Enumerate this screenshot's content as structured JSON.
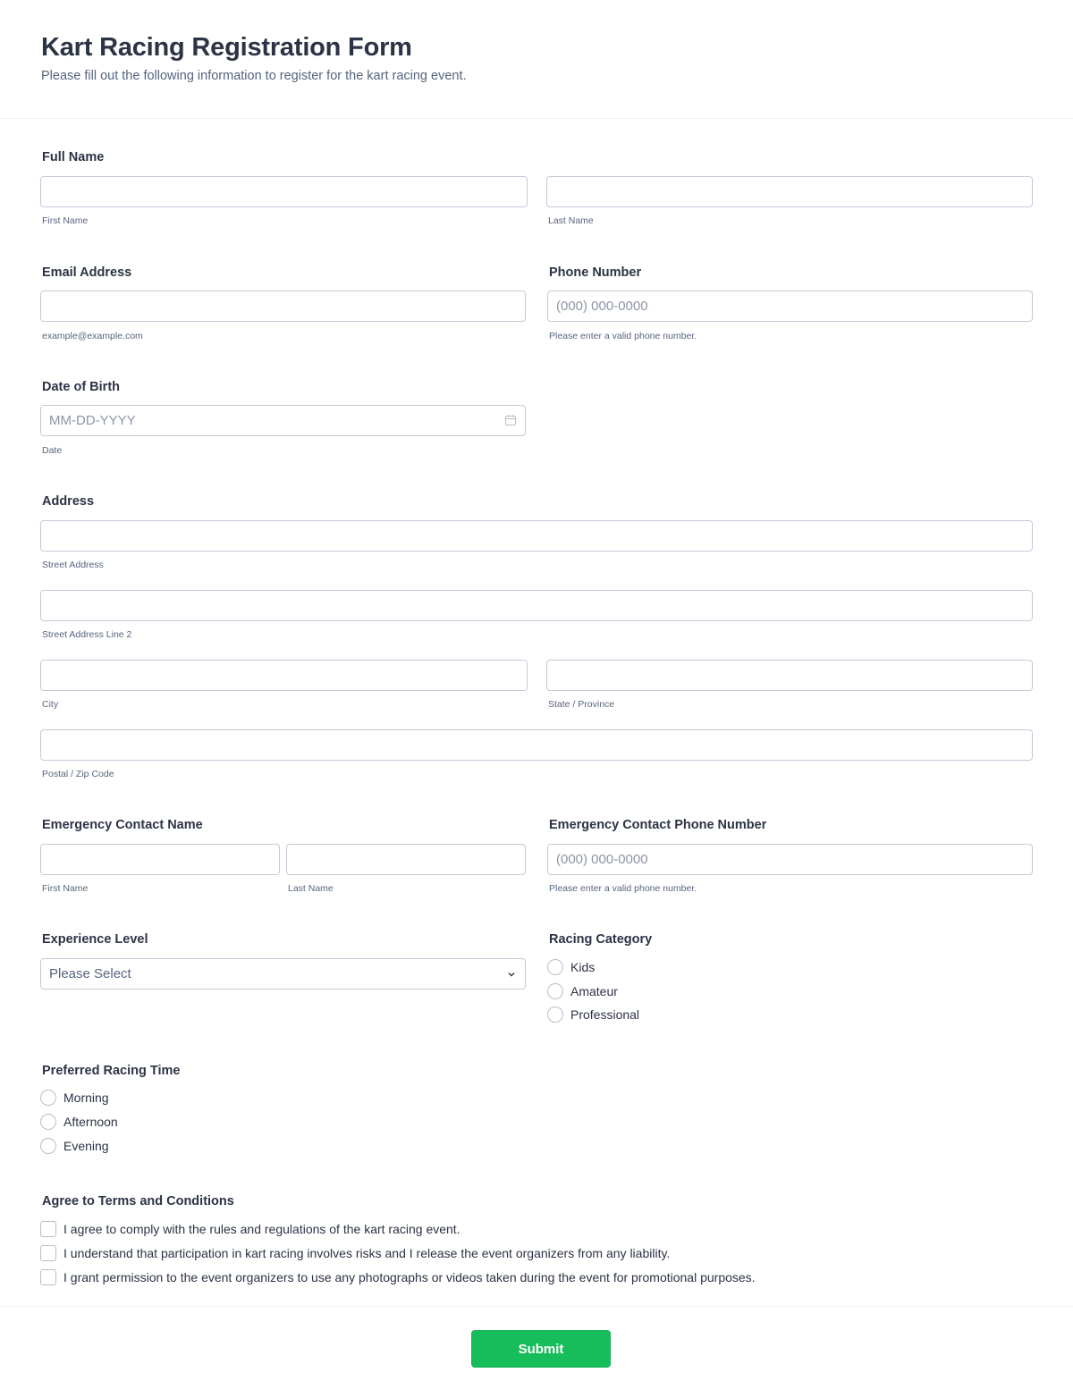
{
  "header": {
    "title": "Kart Racing Registration Form",
    "subtitle": "Please fill out the following information to register for the kart racing event."
  },
  "full_name": {
    "label": "Full Name",
    "first_sublabel": "First Name",
    "last_sublabel": "Last Name",
    "first_value": "",
    "last_value": ""
  },
  "email": {
    "label": "Email Address",
    "sublabel": "example@example.com",
    "value": ""
  },
  "phone": {
    "label": "Phone Number",
    "placeholder": "(000) 000-0000",
    "sublabel": "Please enter a valid phone number."
  },
  "dob": {
    "label": "Date of Birth",
    "placeholder": "MM-DD-YYYY",
    "sublabel": "Date",
    "icon": "calendar-icon"
  },
  "address": {
    "label": "Address",
    "street_sublabel": "Street Address",
    "street2_sublabel": "Street Address Line 2",
    "city_sublabel": "City",
    "state_sublabel": "State / Province",
    "zip_sublabel": "Postal / Zip Code"
  },
  "emergency_name": {
    "label": "Emergency Contact Name",
    "first_sublabel": "First Name",
    "last_sublabel": "Last Name"
  },
  "emergency_phone": {
    "label": "Emergency Contact Phone Number",
    "placeholder": "(000) 000-0000",
    "sublabel": "Please enter a valid phone number."
  },
  "experience": {
    "label": "Experience Level",
    "selected": "Please Select",
    "icon": "chevron-down-icon"
  },
  "racing_category": {
    "label": "Racing Category",
    "options": [
      "Kids",
      "Amateur",
      "Professional"
    ]
  },
  "racing_time": {
    "label": "Preferred Racing Time",
    "options": [
      "Morning",
      "Afternoon",
      "Evening"
    ]
  },
  "terms": {
    "label": "Agree to Terms and Conditions",
    "items": [
      "I agree to comply with the rules and regulations of the kart racing event.",
      "I understand that participation in kart racing involves risks and I release the event organizers from any liability.",
      "I grant permission to the event organizers to use any photographs or videos taken during the event for promotional purposes."
    ]
  },
  "submit": {
    "label": "Submit",
    "color": "#18bd5b"
  }
}
